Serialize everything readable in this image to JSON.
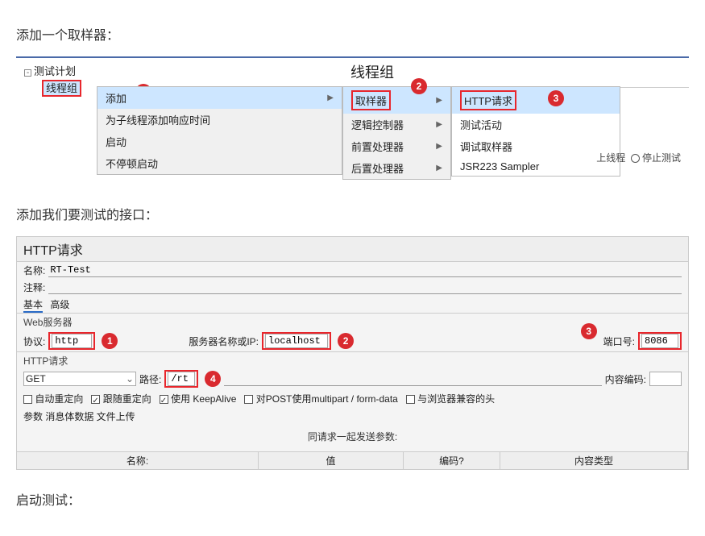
{
  "headings": {
    "h1": "添加一个取样器：",
    "h2": "添加我们要测试的接口：",
    "h3": "启动测试："
  },
  "tree": {
    "plan": "测试计划",
    "group": "线程组"
  },
  "rp_title": "线程组",
  "menu1": {
    "add": "添加",
    "resp": "为子线程添加响应时间",
    "start": "启动",
    "nostop": "不停顿启动"
  },
  "menu2": {
    "sampler": "取样器",
    "logic": "逻辑控制器",
    "pre": "前置处理器",
    "post": "后置处理器"
  },
  "menu3": {
    "http": "HTTP请求",
    "testact": "测试活动",
    "debug": "调试取样器",
    "jsr": "JSR223 Sampler"
  },
  "radio": {
    "thread_text": "上线程",
    "stop_text": "停止测试"
  },
  "badges": {
    "b1": "1",
    "b2": "2",
    "b3": "3",
    "b4": "4"
  },
  "form": {
    "panel_title": "HTTP请求",
    "name_label": "名称:",
    "name_value": "RT-Test",
    "note_label": "注释:",
    "tab_basic": "基本",
    "tab_adv": "高级",
    "web_server": "Web服务器",
    "proto_label": "协议:",
    "proto_value": "http",
    "server_label": "服务器名称或IP:",
    "server_value": "localhost",
    "port_label": "端口号:",
    "port_value": "8086",
    "http_req": "HTTP请求",
    "method": "GET",
    "path_label": "路径:",
    "path_value": "/rt",
    "enc_label": "内容编码:",
    "cb1": "自动重定向",
    "cb2": "跟随重定向",
    "cb3": "使用 KeepAlive",
    "cb4": "对POST使用multipart / form-data",
    "cb5": "与浏览器兼容的头",
    "subtabs": "参数 消息体数据 文件上传",
    "hint": "同请求一起发送参数:",
    "th_name": "名称:",
    "th_val": "值",
    "th_enc": "编码?",
    "th_ctype": "内容类型"
  }
}
